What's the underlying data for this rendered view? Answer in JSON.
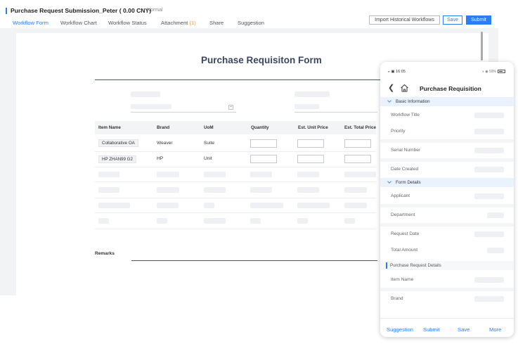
{
  "header": {
    "title": "Purchase Request Submission_Peter ( 0.00 CNY)",
    "status": "Normal"
  },
  "tabs": [
    {
      "label": "Workflow Form",
      "active": true
    },
    {
      "label": "Workflow Chart"
    },
    {
      "label": "Workflow Status"
    },
    {
      "label": "Attachment",
      "badge": "(1)"
    },
    {
      "label": "Share"
    },
    {
      "label": "Suggestion"
    }
  ],
  "toolbar": {
    "import_label": "Import Historical Workflows",
    "save_label": "Save",
    "submit_label": "Submit"
  },
  "form": {
    "title": "Purchase Requisiton Form",
    "columns": [
      "Item Name",
      "Brand",
      "UoM",
      "Quantity",
      "Est. Unit Price",
      "Est. Total Price"
    ],
    "rows": [
      {
        "item": "Collaborative OA",
        "brand": "Weaver",
        "uom": "Suite"
      },
      {
        "item": "HP ZHAN99 G2",
        "brand": "HP",
        "uom": "Unit"
      }
    ],
    "remarks_label": "Remarks"
  },
  "mobile": {
    "status_left": "16:05",
    "status_right": "59%",
    "nav_title": "Purchase Requisition",
    "sections": {
      "basic": "Basic Information",
      "details": "Form Details",
      "request_details": "Purchase Request Details"
    },
    "fields": {
      "workflow_title": "Workflow Title",
      "priority": "Priority",
      "serial_number": "Serial Number",
      "date_created": "Date Created",
      "applicant": "Applicant",
      "department": "Department",
      "request_date": "Request Date",
      "total_amount": "Total Amount",
      "item_name": "Item Name",
      "brand": "Brand"
    },
    "actions": {
      "suggestion": "Suggestion",
      "submit": "Submit",
      "save": "Save",
      "more": "More"
    }
  },
  "colors": {
    "accent": "#2b7cf6",
    "badge": "#f2a33a",
    "form_title": "#3a4660",
    "section_bg": "#eaf3fd"
  }
}
